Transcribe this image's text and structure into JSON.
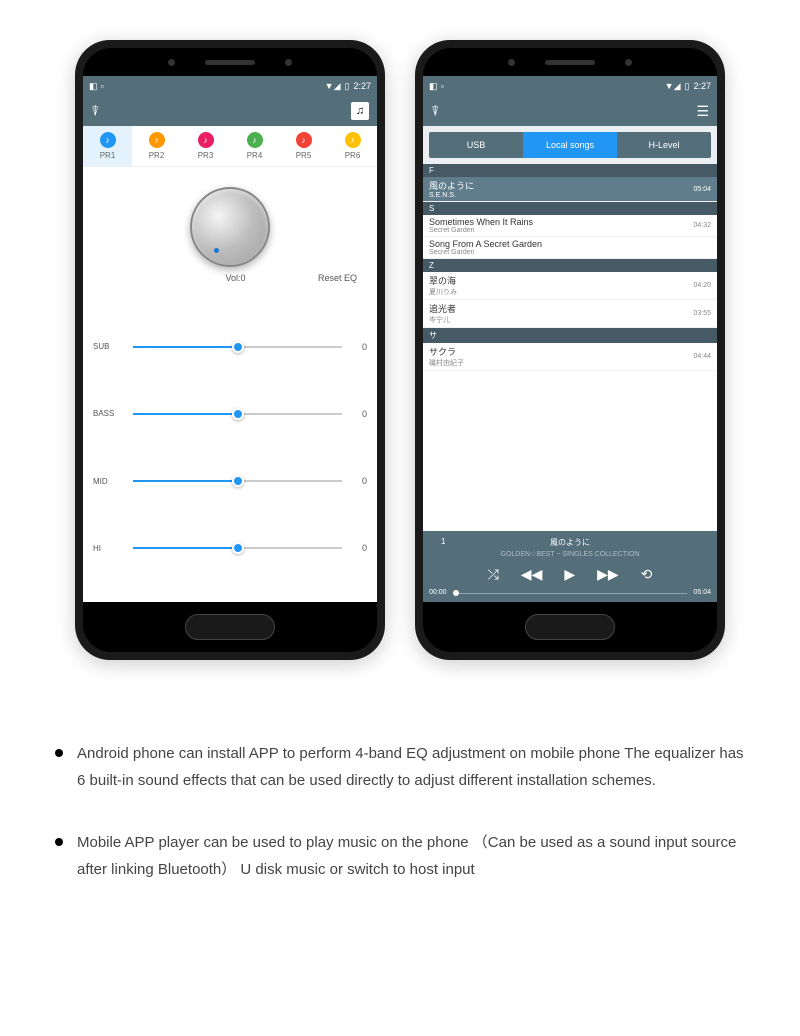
{
  "status": {
    "time": "2:27"
  },
  "eq": {
    "presets": [
      {
        "label": "PR1",
        "colorClass": "pi-blue",
        "active": true
      },
      {
        "label": "PR2",
        "colorClass": "pi-orange",
        "active": false
      },
      {
        "label": "PR3",
        "colorClass": "pi-magenta",
        "active": false
      },
      {
        "label": "PR4",
        "colorClass": "pi-green",
        "active": false
      },
      {
        "label": "PR5",
        "colorClass": "pi-red",
        "active": false
      },
      {
        "label": "PR6",
        "colorClass": "pi-yellow",
        "active": false
      }
    ],
    "volumeLabel": "Vol:0",
    "resetLabel": "Reset EQ",
    "sliders": [
      {
        "label": "SUB",
        "value": "0"
      },
      {
        "label": "BASS",
        "value": "0"
      },
      {
        "label": "MID",
        "value": "0"
      },
      {
        "label": "HI",
        "value": "0"
      }
    ]
  },
  "player": {
    "tabs": [
      {
        "label": "USB",
        "active": false
      },
      {
        "label": "Local songs",
        "active": true
      },
      {
        "label": "H-Level",
        "active": false
      }
    ],
    "sections": [
      {
        "header": "F"
      },
      {
        "title": "風のように",
        "artist": "S.E.N.S.",
        "time": "05:04",
        "highlight": true
      },
      {
        "header": "S"
      },
      {
        "title": "Sometimes When It Rains",
        "artist": "Secret Garden",
        "time": "04:32"
      },
      {
        "title": "Song From A Secret Garden",
        "artist": "Secret Garden",
        "time": ""
      },
      {
        "header": "Z"
      },
      {
        "title": "翠の海",
        "artist": "夏川りみ",
        "time": "04:20"
      },
      {
        "title": "追光者",
        "artist": "岑宁儿",
        "time": "03:55"
      },
      {
        "header": "サ"
      },
      {
        "title": "サクラ",
        "artist": "磯村由紀子",
        "time": "04:44"
      }
    ],
    "nowPlaying": {
      "number": "1",
      "title": "風のように",
      "album": "GOLDEN☆BEST ~ SINGLES COLLECTION",
      "currentTime": "00:00",
      "totalTime": "05:04"
    }
  },
  "desc": {
    "bullet1": "Android phone can install APP to perform 4-band EQ adjustment on mobile phone The equalizer has 6 built-in sound effects that can be used directly to adjust different installation schemes.",
    "bullet2": "Mobile APP player can be used to play music on the phone （Can be used as a sound input source after linking Bluetooth） U disk music or switch to host input"
  }
}
